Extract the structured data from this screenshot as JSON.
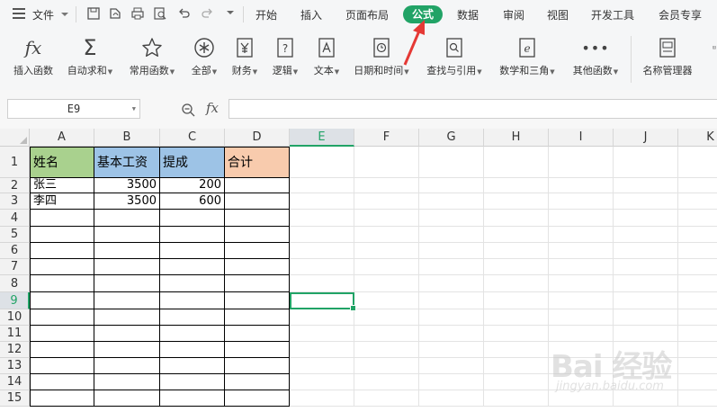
{
  "menu": {
    "file": "文件",
    "tabs": [
      "开始",
      "插入",
      "页面布局",
      "公式",
      "数据",
      "审阅",
      "视图",
      "开发工具",
      "会员专享"
    ],
    "active_tab": "公式"
  },
  "ribbon": {
    "buttons": [
      {
        "label": "插入函数",
        "icon": "fx-icon",
        "dropdown": false
      },
      {
        "label": "自动求和",
        "icon": "sigma-icon",
        "dropdown": true
      },
      {
        "label": "常用函数",
        "icon": "star-icon",
        "dropdown": true
      },
      {
        "label": "全部",
        "icon": "asterisk-icon",
        "dropdown": true
      },
      {
        "label": "财务",
        "icon": "yen-icon",
        "dropdown": true
      },
      {
        "label": "逻辑",
        "icon": "question-icon",
        "dropdown": true
      },
      {
        "label": "文本",
        "icon": "text-a-icon",
        "dropdown": true
      },
      {
        "label": "日期和时间",
        "icon": "clock-icon",
        "dropdown": true
      },
      {
        "label": "查找与引用",
        "icon": "search-doc-icon",
        "dropdown": true
      },
      {
        "label": "数学和三角",
        "icon": "theta-icon",
        "dropdown": true
      },
      {
        "label": "其他函数",
        "icon": "more-icon",
        "dropdown": true
      },
      {
        "label": "名称管理器",
        "icon": "name-manager-icon",
        "dropdown": false
      }
    ]
  },
  "formula_bar": {
    "name_box": "E9",
    "fx_label": "fx",
    "formula": ""
  },
  "sheet": {
    "columns": [
      "A",
      "B",
      "C",
      "D",
      "E",
      "F",
      "G",
      "H",
      "I",
      "J",
      "K"
    ],
    "rows": [
      "1",
      "2",
      "3",
      "4",
      "5",
      "6",
      "7",
      "8",
      "9",
      "10",
      "11",
      "12",
      "13",
      "14",
      "15"
    ],
    "selected_cell": "E9",
    "header_colors": {
      "A": "#a9d18e",
      "B": "#9dc3e6",
      "C": "#9dc3e6",
      "D": "#f8cbad"
    },
    "cells": {
      "A1": "姓名",
      "B1": "基本工资",
      "C1": "提成",
      "D1": "合计",
      "A2": "张三",
      "B2": "3500",
      "C2": "200",
      "A3": "李四",
      "B3": "3500",
      "C3": "600"
    }
  },
  "watermark": {
    "line1": "Bai 经验",
    "line2": "jingyan.baidu.com"
  }
}
